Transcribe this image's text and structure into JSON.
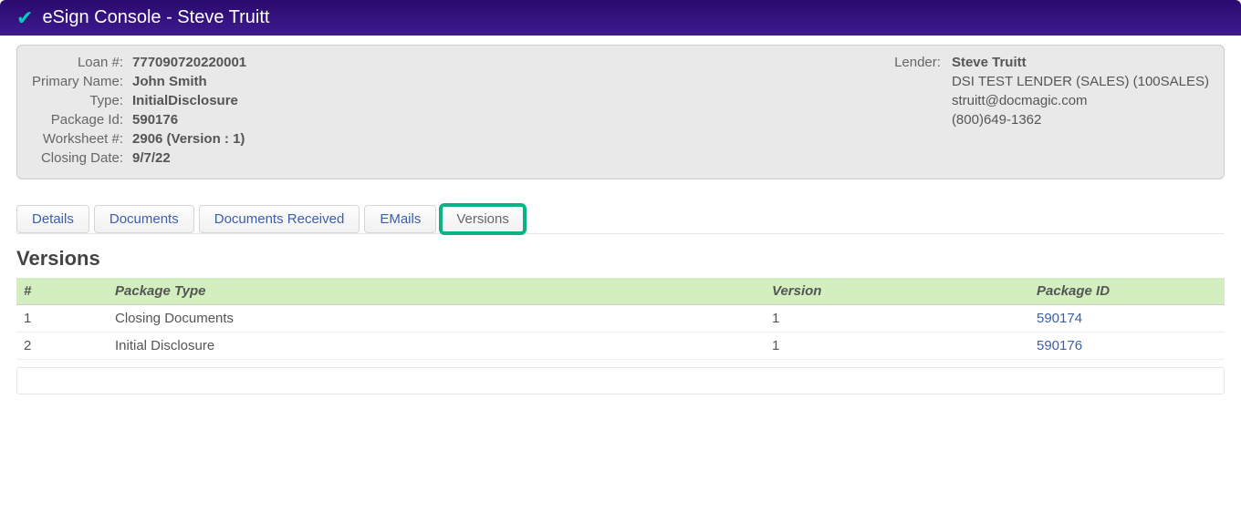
{
  "header": {
    "title": "eSign Console - Steve Truitt"
  },
  "info": {
    "labels": {
      "loan": "Loan #:",
      "primary_name": "Primary Name:",
      "type": "Type:",
      "package_id": "Package Id:",
      "worksheet": "Worksheet #:",
      "closing_date": "Closing Date:",
      "lender": "Lender:"
    },
    "values": {
      "loan": "777090720220001",
      "primary_name": "John Smith",
      "type": "InitialDisclosure",
      "package_id": "590176",
      "worksheet": "2906 (Version : 1)",
      "closing_date": "9/7/22"
    },
    "lender": {
      "name": "Steve Truitt",
      "org": "DSI TEST LENDER (SALES) (100SALES)",
      "email": "struitt@docmagic.com",
      "phone": "(800)649-1362"
    }
  },
  "tabs": {
    "details": "Details",
    "documents": "Documents",
    "documents_received": "Documents Received",
    "emails": "EMails",
    "versions": "Versions"
  },
  "section": {
    "heading": "Versions"
  },
  "table": {
    "headers": {
      "num": "#",
      "package_type": "Package Type",
      "version": "Version",
      "package_id": "Package ID"
    },
    "rows": [
      {
        "num": "1",
        "package_type": "Closing Documents",
        "version": "1",
        "package_id": "590174"
      },
      {
        "num": "2",
        "package_type": "Initial Disclosure",
        "version": "1",
        "package_id": "590176"
      }
    ]
  }
}
